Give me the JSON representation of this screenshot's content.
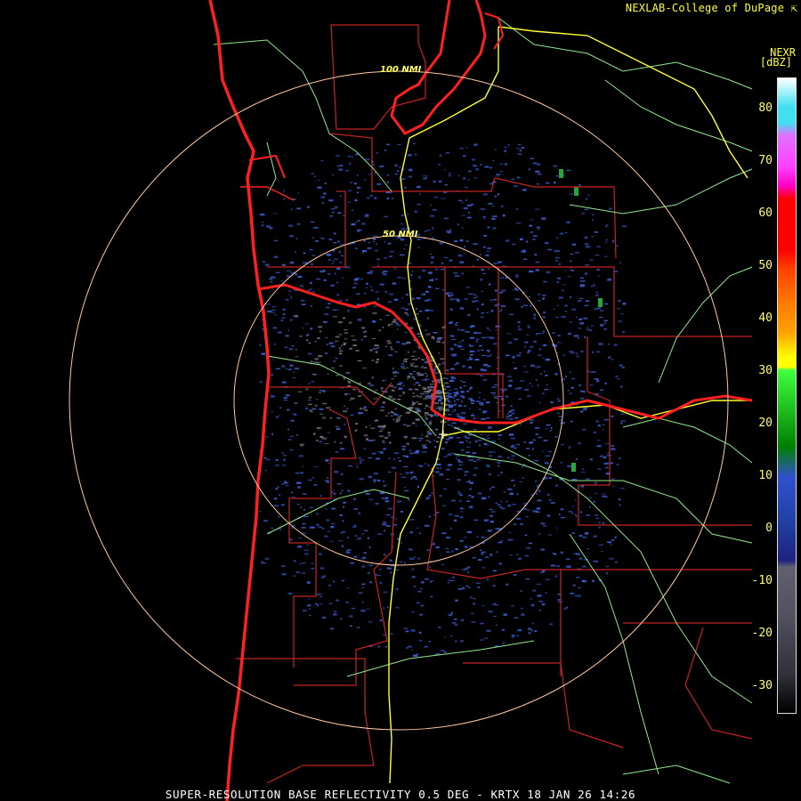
{
  "header": {
    "credit": "NEXLAB-College of DuPage",
    "product": "NEXR",
    "units": "[dBZ]"
  },
  "footer": {
    "caption": "SUPER-RESOLUTION BASE REFLECTIVITY 0.5 DEG - KRTX 18 JAN 26 14:26"
  },
  "range_rings": [
    {
      "label": "50 NMI"
    },
    {
      "label": "100 NMI"
    }
  ],
  "legend": {
    "ticks": [
      "80",
      "70",
      "60",
      "50",
      "40",
      "30",
      "20",
      "10",
      "0",
      "-10",
      "-20",
      "-30"
    ]
  },
  "colors": {
    "state_border": "#ff2020",
    "county_border": "#c42424",
    "highway": "#ffff33",
    "road": "#90e890",
    "ring": "#ffc8a0",
    "echo_light": "#3a5bcc",
    "echo_clutter": "#707080",
    "echo_moderate": "#2aa53a"
  }
}
